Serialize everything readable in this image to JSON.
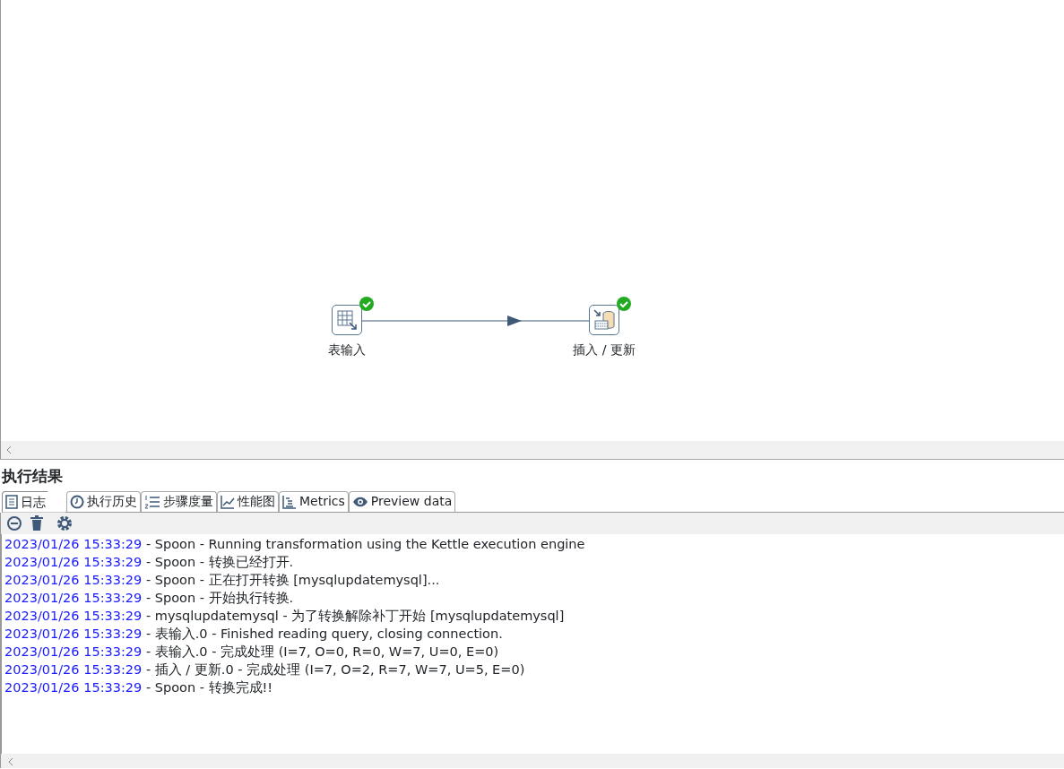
{
  "canvas": {
    "steps": [
      {
        "label": "表输入",
        "finished": true
      },
      {
        "label": "插入 / 更新",
        "finished": true
      }
    ]
  },
  "results": {
    "title": "执行结果",
    "tabs": [
      {
        "label": "日志",
        "selected": true
      },
      {
        "label": "执行历史",
        "selected": false
      },
      {
        "label": "步骤度量",
        "selected": false
      },
      {
        "label": "性能图",
        "selected": false
      },
      {
        "label": "Metrics",
        "selected": false
      },
      {
        "label": "Preview data",
        "selected": false
      }
    ],
    "log": [
      {
        "time": "2023/01/26 15:33:29",
        "message": "- Spoon - Running transformation using the Kettle execution engine"
      },
      {
        "time": "2023/01/26 15:33:29",
        "message": "- Spoon - 转换已经打开."
      },
      {
        "time": "2023/01/26 15:33:29",
        "message": "- Spoon - 正在打开转换 [mysqlupdatemysql]..."
      },
      {
        "time": "2023/01/26 15:33:29",
        "message": "- Spoon - 开始执行转换."
      },
      {
        "time": "2023/01/26 15:33:29",
        "message": "- mysqlupdatemysql - 为了转换解除补丁开始  [mysqlupdatemysql]"
      },
      {
        "time": "2023/01/26 15:33:29",
        "message": "- 表输入.0 - Finished reading query, closing connection."
      },
      {
        "time": "2023/01/26 15:33:29",
        "message": "- 表输入.0 - 完成处理 (I=7, O=0, R=0, W=7, U=0, E=0)"
      },
      {
        "time": "2023/01/26 15:33:29",
        "message": "- 插入 / 更新.0 - 完成处理 (I=7, O=2, R=7, W=7, U=5, E=0)"
      },
      {
        "time": "2023/01/26 15:33:29",
        "message": "- Spoon - 转换完成!!"
      }
    ]
  }
}
